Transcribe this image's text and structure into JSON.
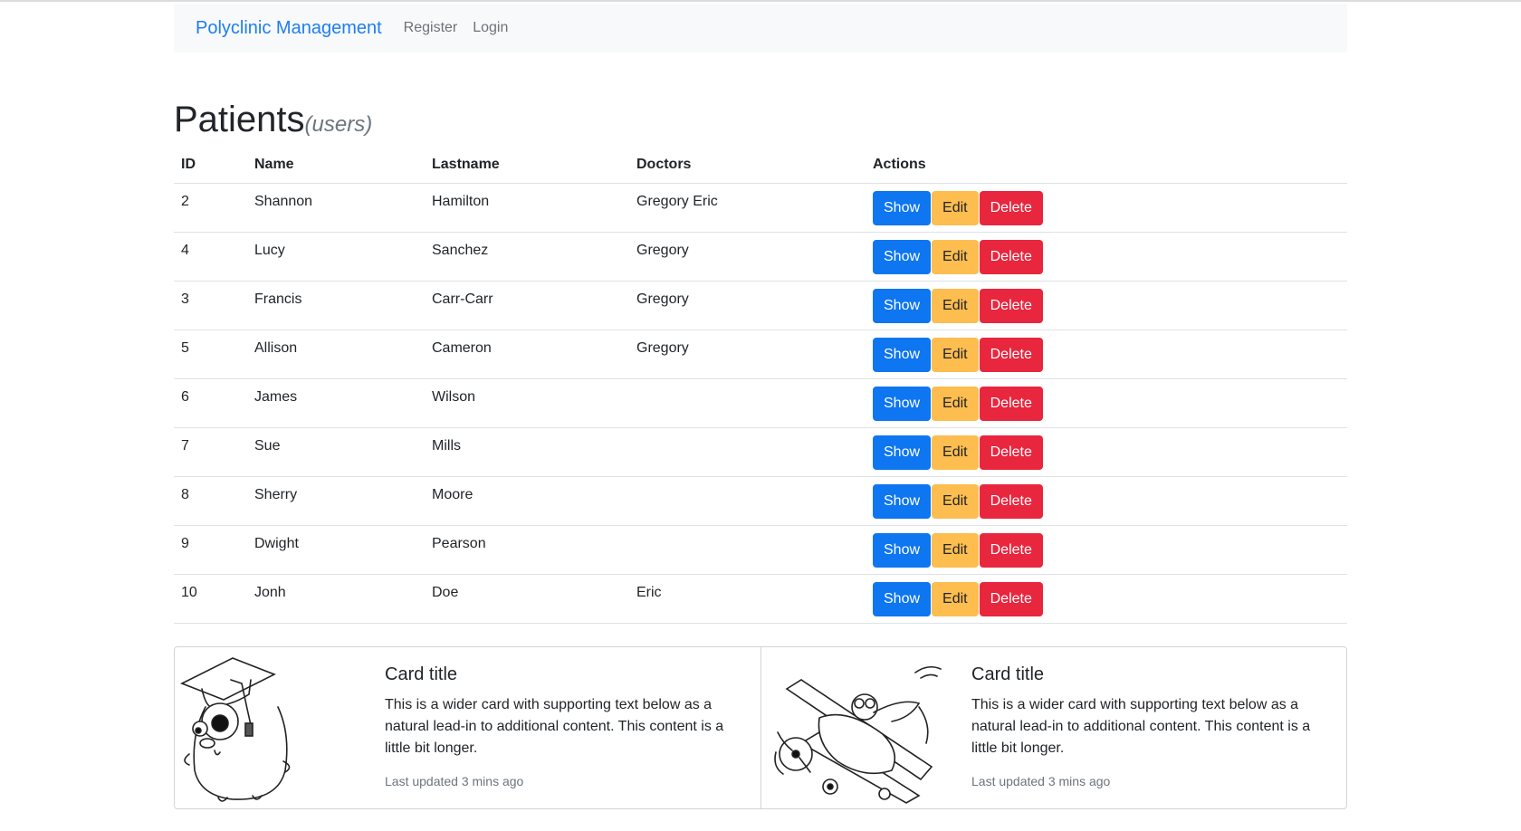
{
  "navbar": {
    "brand": "Polyclinic Management",
    "links": [
      "Register",
      "Login"
    ]
  },
  "page": {
    "title": "Patients",
    "subtitle": "(users)"
  },
  "table": {
    "headers": [
      "ID",
      "Name",
      "Lastname",
      "Doctors",
      "Actions"
    ],
    "rows": [
      {
        "id": "2",
        "name": "Shannon",
        "lastname": "Hamilton",
        "doctors": "Gregory Eric"
      },
      {
        "id": "4",
        "name": "Lucy",
        "lastname": "Sanchez",
        "doctors": "Gregory"
      },
      {
        "id": "3",
        "name": "Francis",
        "lastname": "Carr-Carr",
        "doctors": "Gregory"
      },
      {
        "id": "5",
        "name": "Allison",
        "lastname": "Cameron",
        "doctors": "Gregory"
      },
      {
        "id": "6",
        "name": "James",
        "lastname": "Wilson",
        "doctors": ""
      },
      {
        "id": "7",
        "name": "Sue",
        "lastname": "Mills",
        "doctors": ""
      },
      {
        "id": "8",
        "name": "Sherry",
        "lastname": "Moore",
        "doctors": ""
      },
      {
        "id": "9",
        "name": "Dwight",
        "lastname": "Pearson",
        "doctors": ""
      },
      {
        "id": "10",
        "name": "Jonh",
        "lastname": "Doe",
        "doctors": "Eric"
      }
    ],
    "actions": {
      "show": "Show",
      "edit": "Edit",
      "delete": "Delete"
    }
  },
  "cards": [
    {
      "image": "gopher-graduate-icon",
      "title": "Card title",
      "text": "This is a wider card with supporting text below as a natural lead-in to additional content. This content is a little bit longer.",
      "updated": "Last updated 3 mins ago"
    },
    {
      "image": "gopher-biplane-icon",
      "title": "Card title",
      "text": "This is a wider card with supporting text below as a natural lead-in to additional content. This content is a little bit longer.",
      "updated": "Last updated 3 mins ago"
    }
  ],
  "colors": {
    "primary": "#0d76f0",
    "warning": "#fdbd4f",
    "danger": "#e8263e",
    "brand_link": "#1e7ef0",
    "navbar_bg": "#f8f9fa"
  }
}
